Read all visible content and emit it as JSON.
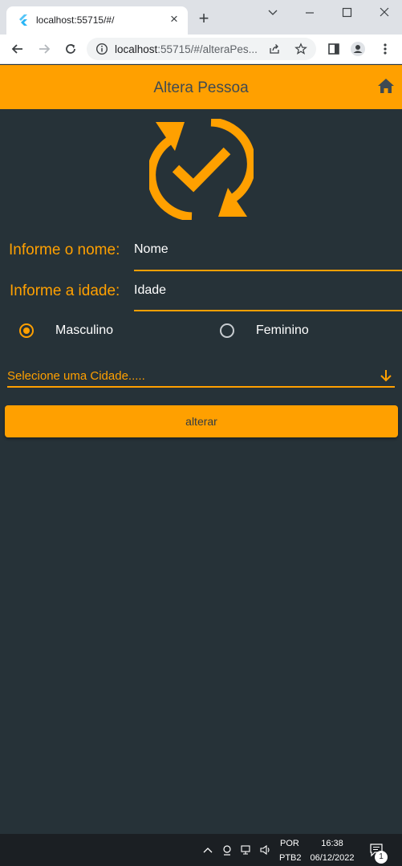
{
  "browser": {
    "tab_title": "localhost:55715/#/",
    "url_host": "localhost",
    "url_rest": ":55715/#/alteraPes..."
  },
  "app": {
    "title": "Altera Pessoa",
    "name_label": "Informe o nome:",
    "name_value": "Nome",
    "age_label": "Informe a idade:",
    "age_value": "Idade",
    "gender": {
      "options": [
        "Masculino",
        "Feminino"
      ],
      "selected": "Masculino"
    },
    "city_placeholder": "Selecione uma Cidade.....",
    "submit_label": "alterar",
    "accent_color": "#ffa000",
    "background_color": "#263238"
  },
  "taskbar": {
    "lang": "POR",
    "layout": "PTB2",
    "time": "16:38",
    "date": "06/12/2022",
    "notification_count": "1"
  }
}
